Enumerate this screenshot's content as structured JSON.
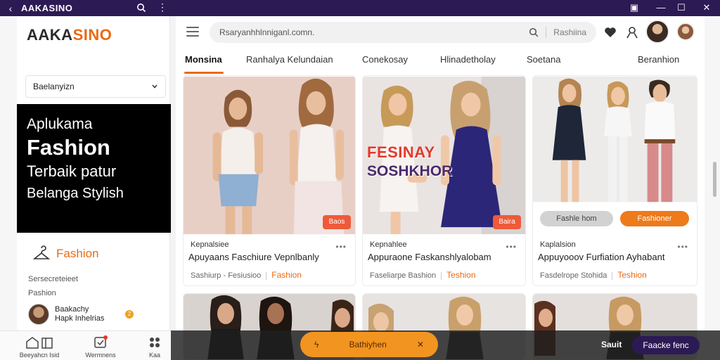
{
  "titlebar": {
    "back": "‹",
    "title": "AAKASINO",
    "menu": "⋮",
    "controls": [
      "▣",
      "—",
      "☐",
      "✕"
    ]
  },
  "sidebar": {
    "logo_main": "AAKA",
    "logo_accent": "SINO",
    "select_value": "Baelanyizn",
    "promo": {
      "line1": "Aplukama",
      "line2": "Fashion",
      "line3": "Terbaik patur",
      "line4": "Belanga Stylish"
    },
    "fashion_link": "Fashion",
    "small1": "Sersecreteieet",
    "small2": "Pashion",
    "user_line1": "Baakachy",
    "user_line2": "Hapk Inhelrias",
    "user_badge": "2"
  },
  "bottomnav": {
    "items": [
      {
        "label": "Beeyahcn Isid"
      },
      {
        "label": "Wermnens"
      },
      {
        "label": "Kaa"
      }
    ]
  },
  "header": {
    "search_placeholder": "Rsaryanhhlnniganl.comn.",
    "search_category": "Rashiina"
  },
  "tabs": [
    {
      "label": "Monsina"
    },
    {
      "label": "Ranhalya Kelundaian"
    },
    {
      "label": "Conekosay"
    },
    {
      "label": "Hlinadetholay"
    },
    {
      "label": "Soetana"
    },
    {
      "label": "Beranhion"
    }
  ],
  "cards": [
    {
      "sale": "Baos",
      "meta": "Kepnalsiee",
      "title": "Apuyaans Faschiure Vepnlbanly",
      "info": "Sashiurp - Fesiusioo",
      "accent": "Fashion",
      "dots": "•••"
    },
    {
      "sale": "Baira",
      "meta": "Kepnahlee",
      "title": "Appuraone Faskanshlyalobam",
      "info": "Faseliarpe Bashion",
      "accent": "Teshion",
      "dots": "•••",
      "promo_line1": "FESINAY",
      "promo_line2": "SOSHKHOR"
    },
    {
      "meta": "Kaplalsion",
      "title": "Appuyooov Furfiation Ayhabant",
      "info": "Fasdelrope Stohida",
      "accent": "Teshion",
      "dots": "•••",
      "pill_left": "Fashle hom",
      "pill_right": "Fashioner"
    }
  ],
  "overlay": {
    "pill_icon": "ϟ",
    "pill_label": "Bathiyhen",
    "pill_close": "✕",
    "save": "Sauit",
    "button": "Faacke fenc"
  },
  "colors": {
    "accent": "#ea6a12",
    "titlebar": "#2c1a55",
    "sale": "#ee5a3a"
  }
}
